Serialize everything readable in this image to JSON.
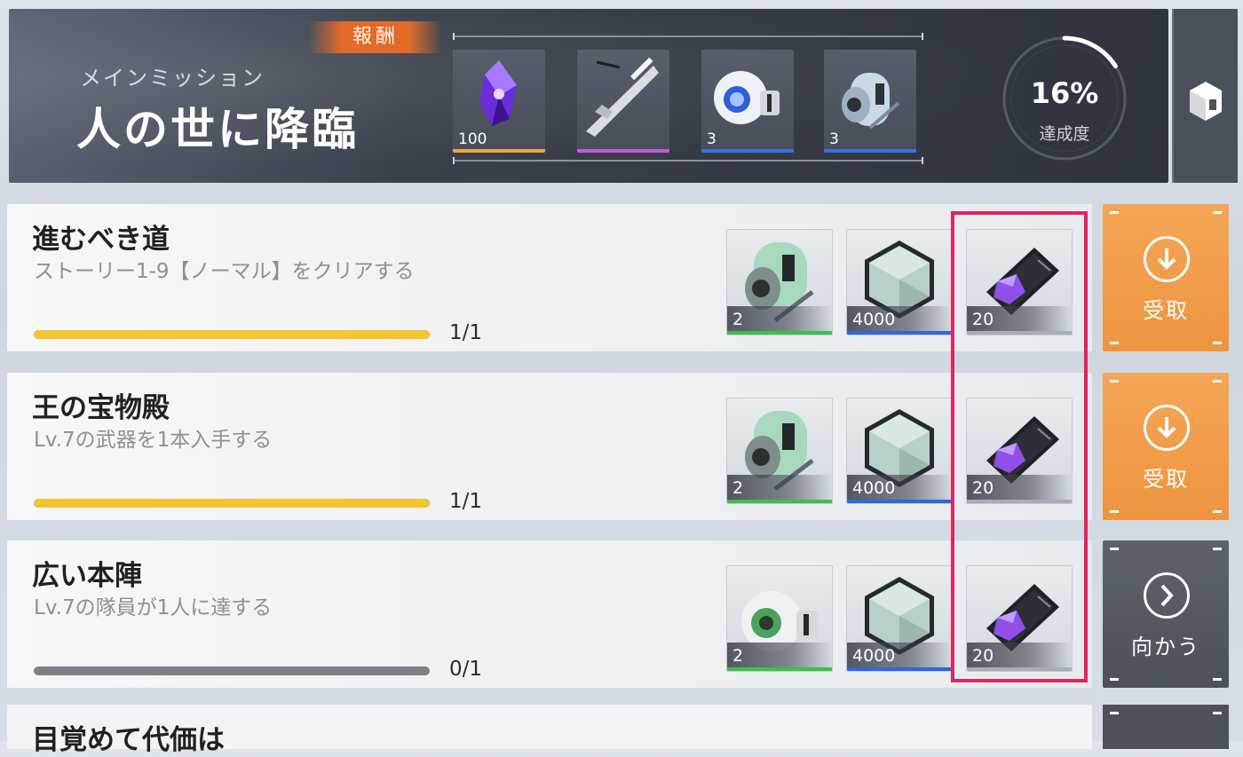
{
  "header": {
    "subtitle": "メインミッション",
    "title": "人の世に降臨",
    "reward_label": "報酬",
    "rewards": [
      {
        "icon": "purple-crystal-icon",
        "qty": "100",
        "rarity_color": "#f0a53a"
      },
      {
        "icon": "rifle-icon",
        "qty": "",
        "rarity_color": "#c15fd6"
      },
      {
        "icon": "orb-capsule-icon",
        "qty": "3",
        "rarity_color": "#3b6ee8"
      },
      {
        "icon": "canister-icon",
        "qty": "3",
        "rarity_color": "#3b6ee8"
      }
    ],
    "progress_percent": "16%",
    "progress_value": 0.16,
    "progress_label": "達成度"
  },
  "missions": [
    {
      "title": "進むべき道",
      "desc": "ストーリー1-9【ノーマル】をクリアする",
      "progress": 1,
      "count": "1/1",
      "rewards": [
        {
          "icon": "green-canister-icon",
          "qty": "2",
          "rarity_color": "#3fbf4a"
        },
        {
          "icon": "hexagon-crystal-icon",
          "qty": "4000",
          "rarity_color": "#2f67e0"
        },
        {
          "icon": "purple-chip-card-icon",
          "qty": "20",
          "rarity_color": "#a9adb5"
        }
      ],
      "action": {
        "label": "受取",
        "icon": "download-icon",
        "style": "orange"
      }
    },
    {
      "title": "王の宝物殿",
      "desc": "Lv.7の武器を1本入手する",
      "progress": 1,
      "count": "1/1",
      "rewards": [
        {
          "icon": "green-canister-icon",
          "qty": "2",
          "rarity_color": "#3fbf4a"
        },
        {
          "icon": "hexagon-crystal-icon",
          "qty": "4000",
          "rarity_color": "#2f67e0"
        },
        {
          "icon": "purple-chip-card-icon",
          "qty": "20",
          "rarity_color": "#a9adb5"
        }
      ],
      "action": {
        "label": "受取",
        "icon": "download-icon",
        "style": "orange"
      }
    },
    {
      "title": "広い本陣",
      "desc": "Lv.7の隊員が1人に達する",
      "progress": 0,
      "count": "0/1",
      "rewards": [
        {
          "icon": "green-orb-capsule-icon",
          "qty": "2",
          "rarity_color": "#3fbf4a"
        },
        {
          "icon": "hexagon-crystal-icon",
          "qty": "4000",
          "rarity_color": "#2f67e0"
        },
        {
          "icon": "purple-chip-card-icon",
          "qty": "20",
          "rarity_color": "#a9adb5"
        }
      ],
      "action": {
        "label": "向かう",
        "icon": "chevron-right-icon",
        "style": "gray"
      }
    }
  ],
  "next_mission": {
    "title": "目覚めて代価は"
  }
}
